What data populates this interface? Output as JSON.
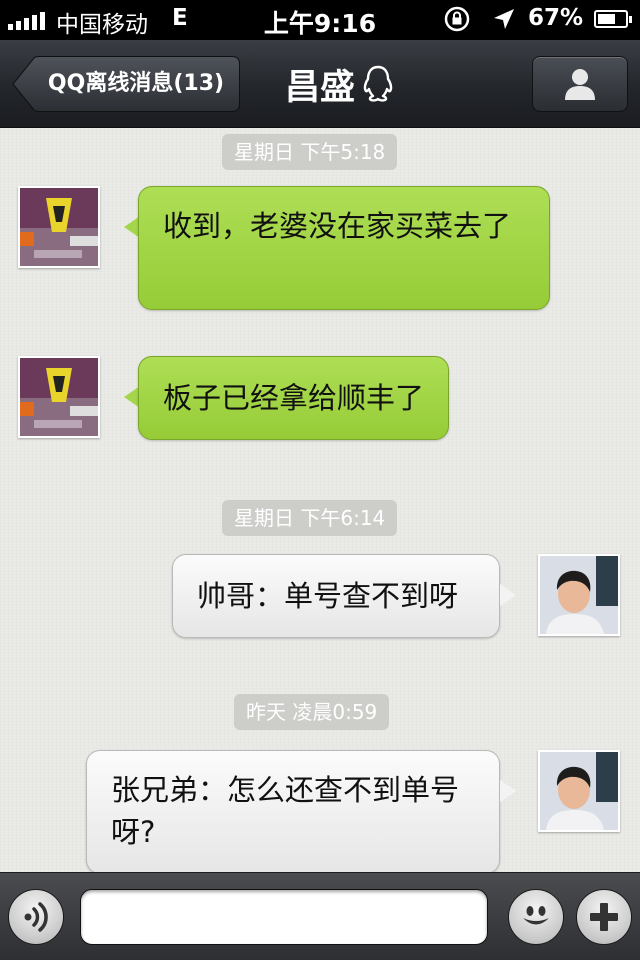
{
  "status_bar": {
    "carrier": "中国移动",
    "network": "E",
    "time": "上午9:16",
    "battery": "67%",
    "battery_level": 0.67
  },
  "nav": {
    "back_label": "QQ离线消息(13)",
    "title": "昌盛"
  },
  "messages": [
    {
      "type": "timestamp",
      "text": "星期日 下午5:18"
    },
    {
      "type": "incoming",
      "text": "收到，老婆没在家买菜去了"
    },
    {
      "type": "incoming",
      "text": "板子已经拿给顺丰了"
    },
    {
      "type": "timestamp",
      "text": "星期日 下午6:14"
    },
    {
      "type": "outgoing",
      "text": "帅哥：单号查不到呀"
    },
    {
      "type": "timestamp",
      "text": "昨天 凌晨0:59"
    },
    {
      "type": "outgoing",
      "text": "张兄弟：怎么还查不到单号呀?"
    }
  ],
  "input": {
    "value": "",
    "placeholder": ""
  },
  "icons": {
    "voice": "voice-icon",
    "emoji": "emoji-icon",
    "more": "plus-icon",
    "profile": "person-icon",
    "qq": "qq-penguin-icon"
  },
  "colors": {
    "incoming_bubble": "#a3d64a",
    "outgoing_bubble": "#f3f3f3",
    "nav_bar": "#2a2d32"
  }
}
